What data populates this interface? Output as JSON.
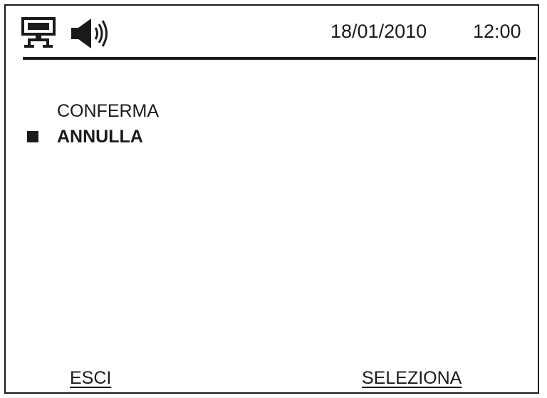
{
  "status_bar": {
    "icons": [
      "network-icon",
      "speaker-icon"
    ],
    "date": "18/01/2010",
    "time": "12:00"
  },
  "menu": {
    "items": [
      {
        "label": "CONFERMA",
        "selected": false
      },
      {
        "label": "ANNULLA",
        "selected": true
      }
    ]
  },
  "softkeys": {
    "left_label": "ESCI",
    "right_label": "SELEZIONA"
  }
}
